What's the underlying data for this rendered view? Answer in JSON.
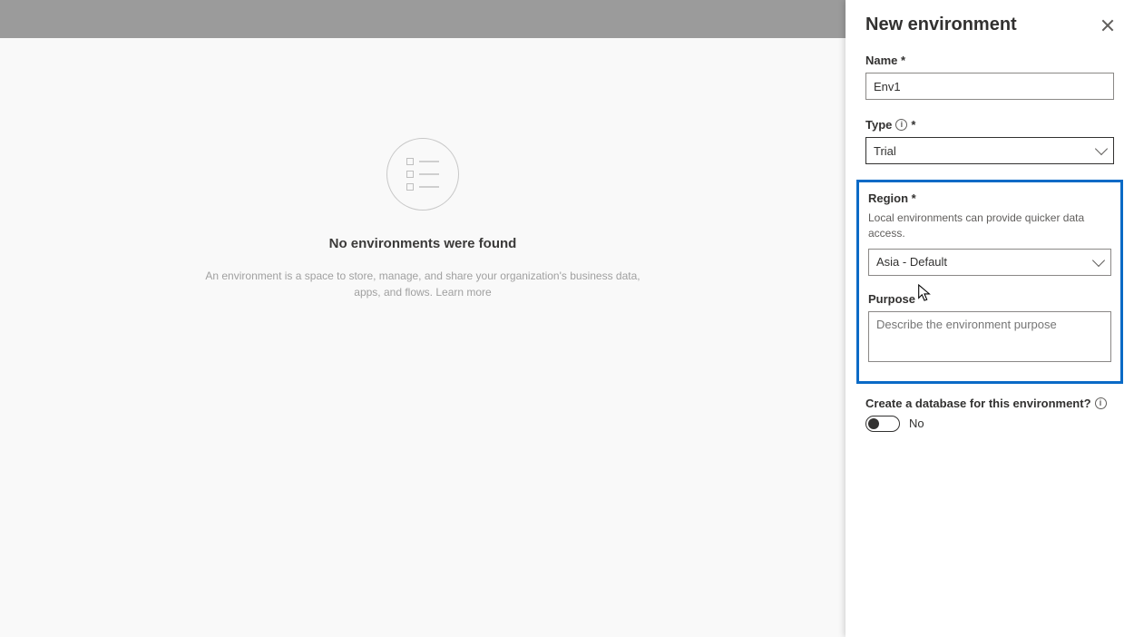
{
  "panel": {
    "title": "New environment",
    "name_label": "Name *",
    "name_value": "Env1",
    "type_label": "Type",
    "type_req": "*",
    "type_value": "Trial",
    "region_label": "Region *",
    "region_hint": "Local environments can provide quicker data access.",
    "region_value": "Asia - Default",
    "purpose_label": "Purpose",
    "purpose_placeholder": "Describe the environment purpose",
    "create_db_label": "Create a database for this environment?",
    "create_db_value": "No"
  },
  "empty": {
    "title": "No environments were found",
    "desc_line1": "An environment is a space to store, manage, and share your organization's business data,",
    "desc_line2": "apps, and flows.",
    "learn_more": "Learn more"
  }
}
